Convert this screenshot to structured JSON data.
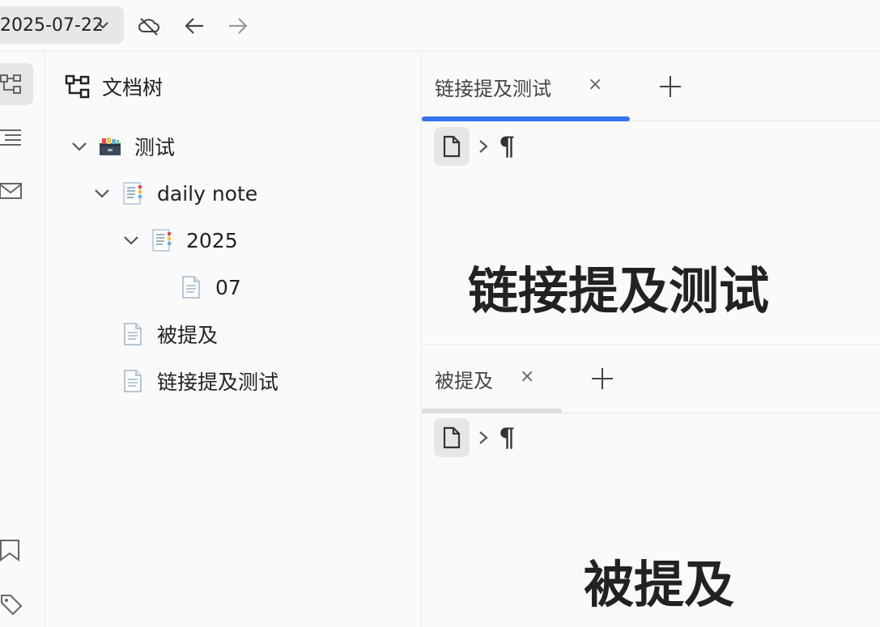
{
  "toolbar": {
    "date": "2025-07-22",
    "icons": [
      "chevron-down-icon",
      "cloud-off-icon",
      "arrow-left-icon",
      "arrow-right-icon"
    ]
  },
  "dock": {
    "items": [
      "file-tree-icon",
      "outline-icon",
      "inbox-icon",
      "bookmark-icon",
      "tag-icon"
    ]
  },
  "tree": {
    "title": "文档树",
    "notebook": "测试",
    "items": [
      {
        "label": "daily note",
        "icon": "notebook-doc-icon"
      },
      {
        "label": "2025",
        "icon": "notebook-doc-icon"
      },
      {
        "label": "07",
        "icon": "doc-icon"
      },
      {
        "label": "被提及",
        "icon": "doc-icon"
      },
      {
        "label": "链接提及测试",
        "icon": "doc-icon"
      }
    ]
  },
  "editors": [
    {
      "tab_label": "链接提及测试",
      "close": "×",
      "title": "链接提及测试",
      "active": true,
      "accent": "#3574f0"
    },
    {
      "tab_label": "被提及",
      "close": "×",
      "title": "被提及",
      "active": false,
      "accent": "#dcdcdc"
    }
  ],
  "breadcrumb": {
    "para_symbol": "¶"
  }
}
